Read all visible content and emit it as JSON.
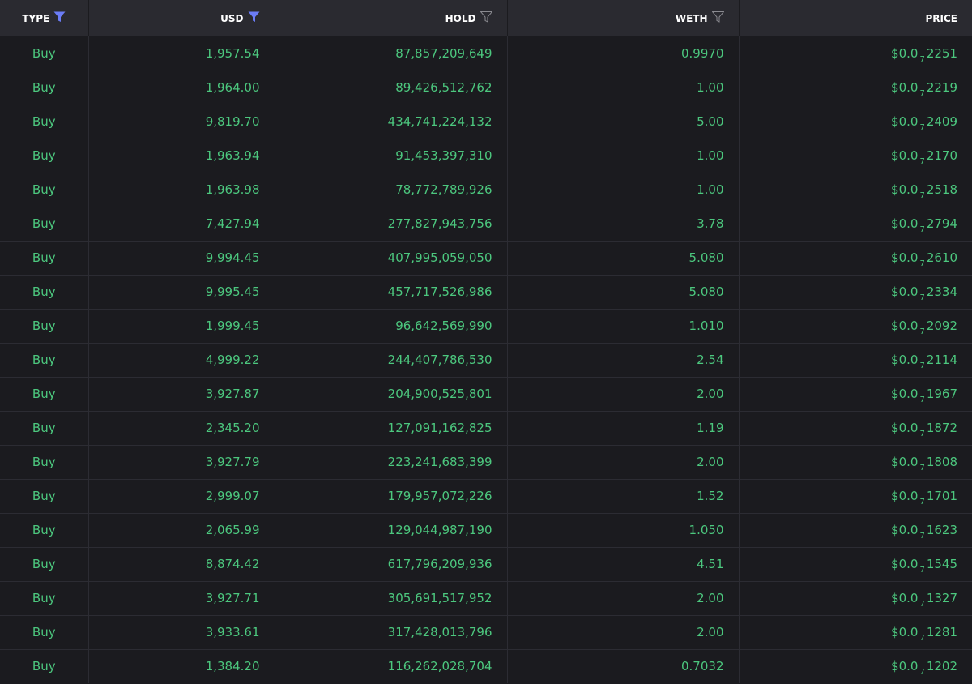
{
  "colors": {
    "background": "#1b1b1f",
    "header_background": "#2a2a30",
    "buy_green": "#4cc77e",
    "filter_active": "#6b7cf6",
    "filter_inactive": "#8a8a90"
  },
  "columns": {
    "type": {
      "label": "TYPE",
      "filter_icon": "filter-active-icon"
    },
    "usd": {
      "label": "USD",
      "filter_icon": "filter-active-icon"
    },
    "hold": {
      "label": "HOLD",
      "filter_icon": "filter-icon"
    },
    "weth": {
      "label": "WETH",
      "filter_icon": "filter-icon"
    },
    "price": {
      "label": "PRICE"
    }
  },
  "rows": [
    {
      "type": "Buy",
      "usd": "1,957.54",
      "hold": "87,857,209,649",
      "weth": "0.9970",
      "price_prefix": "$0.0",
      "price_zeros": "7",
      "price_digits": "2251"
    },
    {
      "type": "Buy",
      "usd": "1,964.00",
      "hold": "89,426,512,762",
      "weth": "1.00",
      "price_prefix": "$0.0",
      "price_zeros": "7",
      "price_digits": "2219"
    },
    {
      "type": "Buy",
      "usd": "9,819.70",
      "hold": "434,741,224,132",
      "weth": "5.00",
      "price_prefix": "$0.0",
      "price_zeros": "7",
      "price_digits": "2409"
    },
    {
      "type": "Buy",
      "usd": "1,963.94",
      "hold": "91,453,397,310",
      "weth": "1.00",
      "price_prefix": "$0.0",
      "price_zeros": "7",
      "price_digits": "2170"
    },
    {
      "type": "Buy",
      "usd": "1,963.98",
      "hold": "78,772,789,926",
      "weth": "1.00",
      "price_prefix": "$0.0",
      "price_zeros": "7",
      "price_digits": "2518"
    },
    {
      "type": "Buy",
      "usd": "7,427.94",
      "hold": "277,827,943,756",
      "weth": "3.78",
      "price_prefix": "$0.0",
      "price_zeros": "7",
      "price_digits": "2794"
    },
    {
      "type": "Buy",
      "usd": "9,994.45",
      "hold": "407,995,059,050",
      "weth": "5.080",
      "price_prefix": "$0.0",
      "price_zeros": "7",
      "price_digits": "2610"
    },
    {
      "type": "Buy",
      "usd": "9,995.45",
      "hold": "457,717,526,986",
      "weth": "5.080",
      "price_prefix": "$0.0",
      "price_zeros": "7",
      "price_digits": "2334"
    },
    {
      "type": "Buy",
      "usd": "1,999.45",
      "hold": "96,642,569,990",
      "weth": "1.010",
      "price_prefix": "$0.0",
      "price_zeros": "7",
      "price_digits": "2092"
    },
    {
      "type": "Buy",
      "usd": "4,999.22",
      "hold": "244,407,786,530",
      "weth": "2.54",
      "price_prefix": "$0.0",
      "price_zeros": "7",
      "price_digits": "2114"
    },
    {
      "type": "Buy",
      "usd": "3,927.87",
      "hold": "204,900,525,801",
      "weth": "2.00",
      "price_prefix": "$0.0",
      "price_zeros": "7",
      "price_digits": "1967"
    },
    {
      "type": "Buy",
      "usd": "2,345.20",
      "hold": "127,091,162,825",
      "weth": "1.19",
      "price_prefix": "$0.0",
      "price_zeros": "7",
      "price_digits": "1872"
    },
    {
      "type": "Buy",
      "usd": "3,927.79",
      "hold": "223,241,683,399",
      "weth": "2.00",
      "price_prefix": "$0.0",
      "price_zeros": "7",
      "price_digits": "1808"
    },
    {
      "type": "Buy",
      "usd": "2,999.07",
      "hold": "179,957,072,226",
      "weth": "1.52",
      "price_prefix": "$0.0",
      "price_zeros": "7",
      "price_digits": "1701"
    },
    {
      "type": "Buy",
      "usd": "2,065.99",
      "hold": "129,044,987,190",
      "weth": "1.050",
      "price_prefix": "$0.0",
      "price_zeros": "7",
      "price_digits": "1623"
    },
    {
      "type": "Buy",
      "usd": "8,874.42",
      "hold": "617,796,209,936",
      "weth": "4.51",
      "price_prefix": "$0.0",
      "price_zeros": "7",
      "price_digits": "1545"
    },
    {
      "type": "Buy",
      "usd": "3,927.71",
      "hold": "305,691,517,952",
      "weth": "2.00",
      "price_prefix": "$0.0",
      "price_zeros": "7",
      "price_digits": "1327"
    },
    {
      "type": "Buy",
      "usd": "3,933.61",
      "hold": "317,428,013,796",
      "weth": "2.00",
      "price_prefix": "$0.0",
      "price_zeros": "7",
      "price_digits": "1281"
    },
    {
      "type": "Buy",
      "usd": "1,384.20",
      "hold": "116,262,028,704",
      "weth": "0.7032",
      "price_prefix": "$0.0",
      "price_zeros": "7",
      "price_digits": "1202"
    }
  ]
}
